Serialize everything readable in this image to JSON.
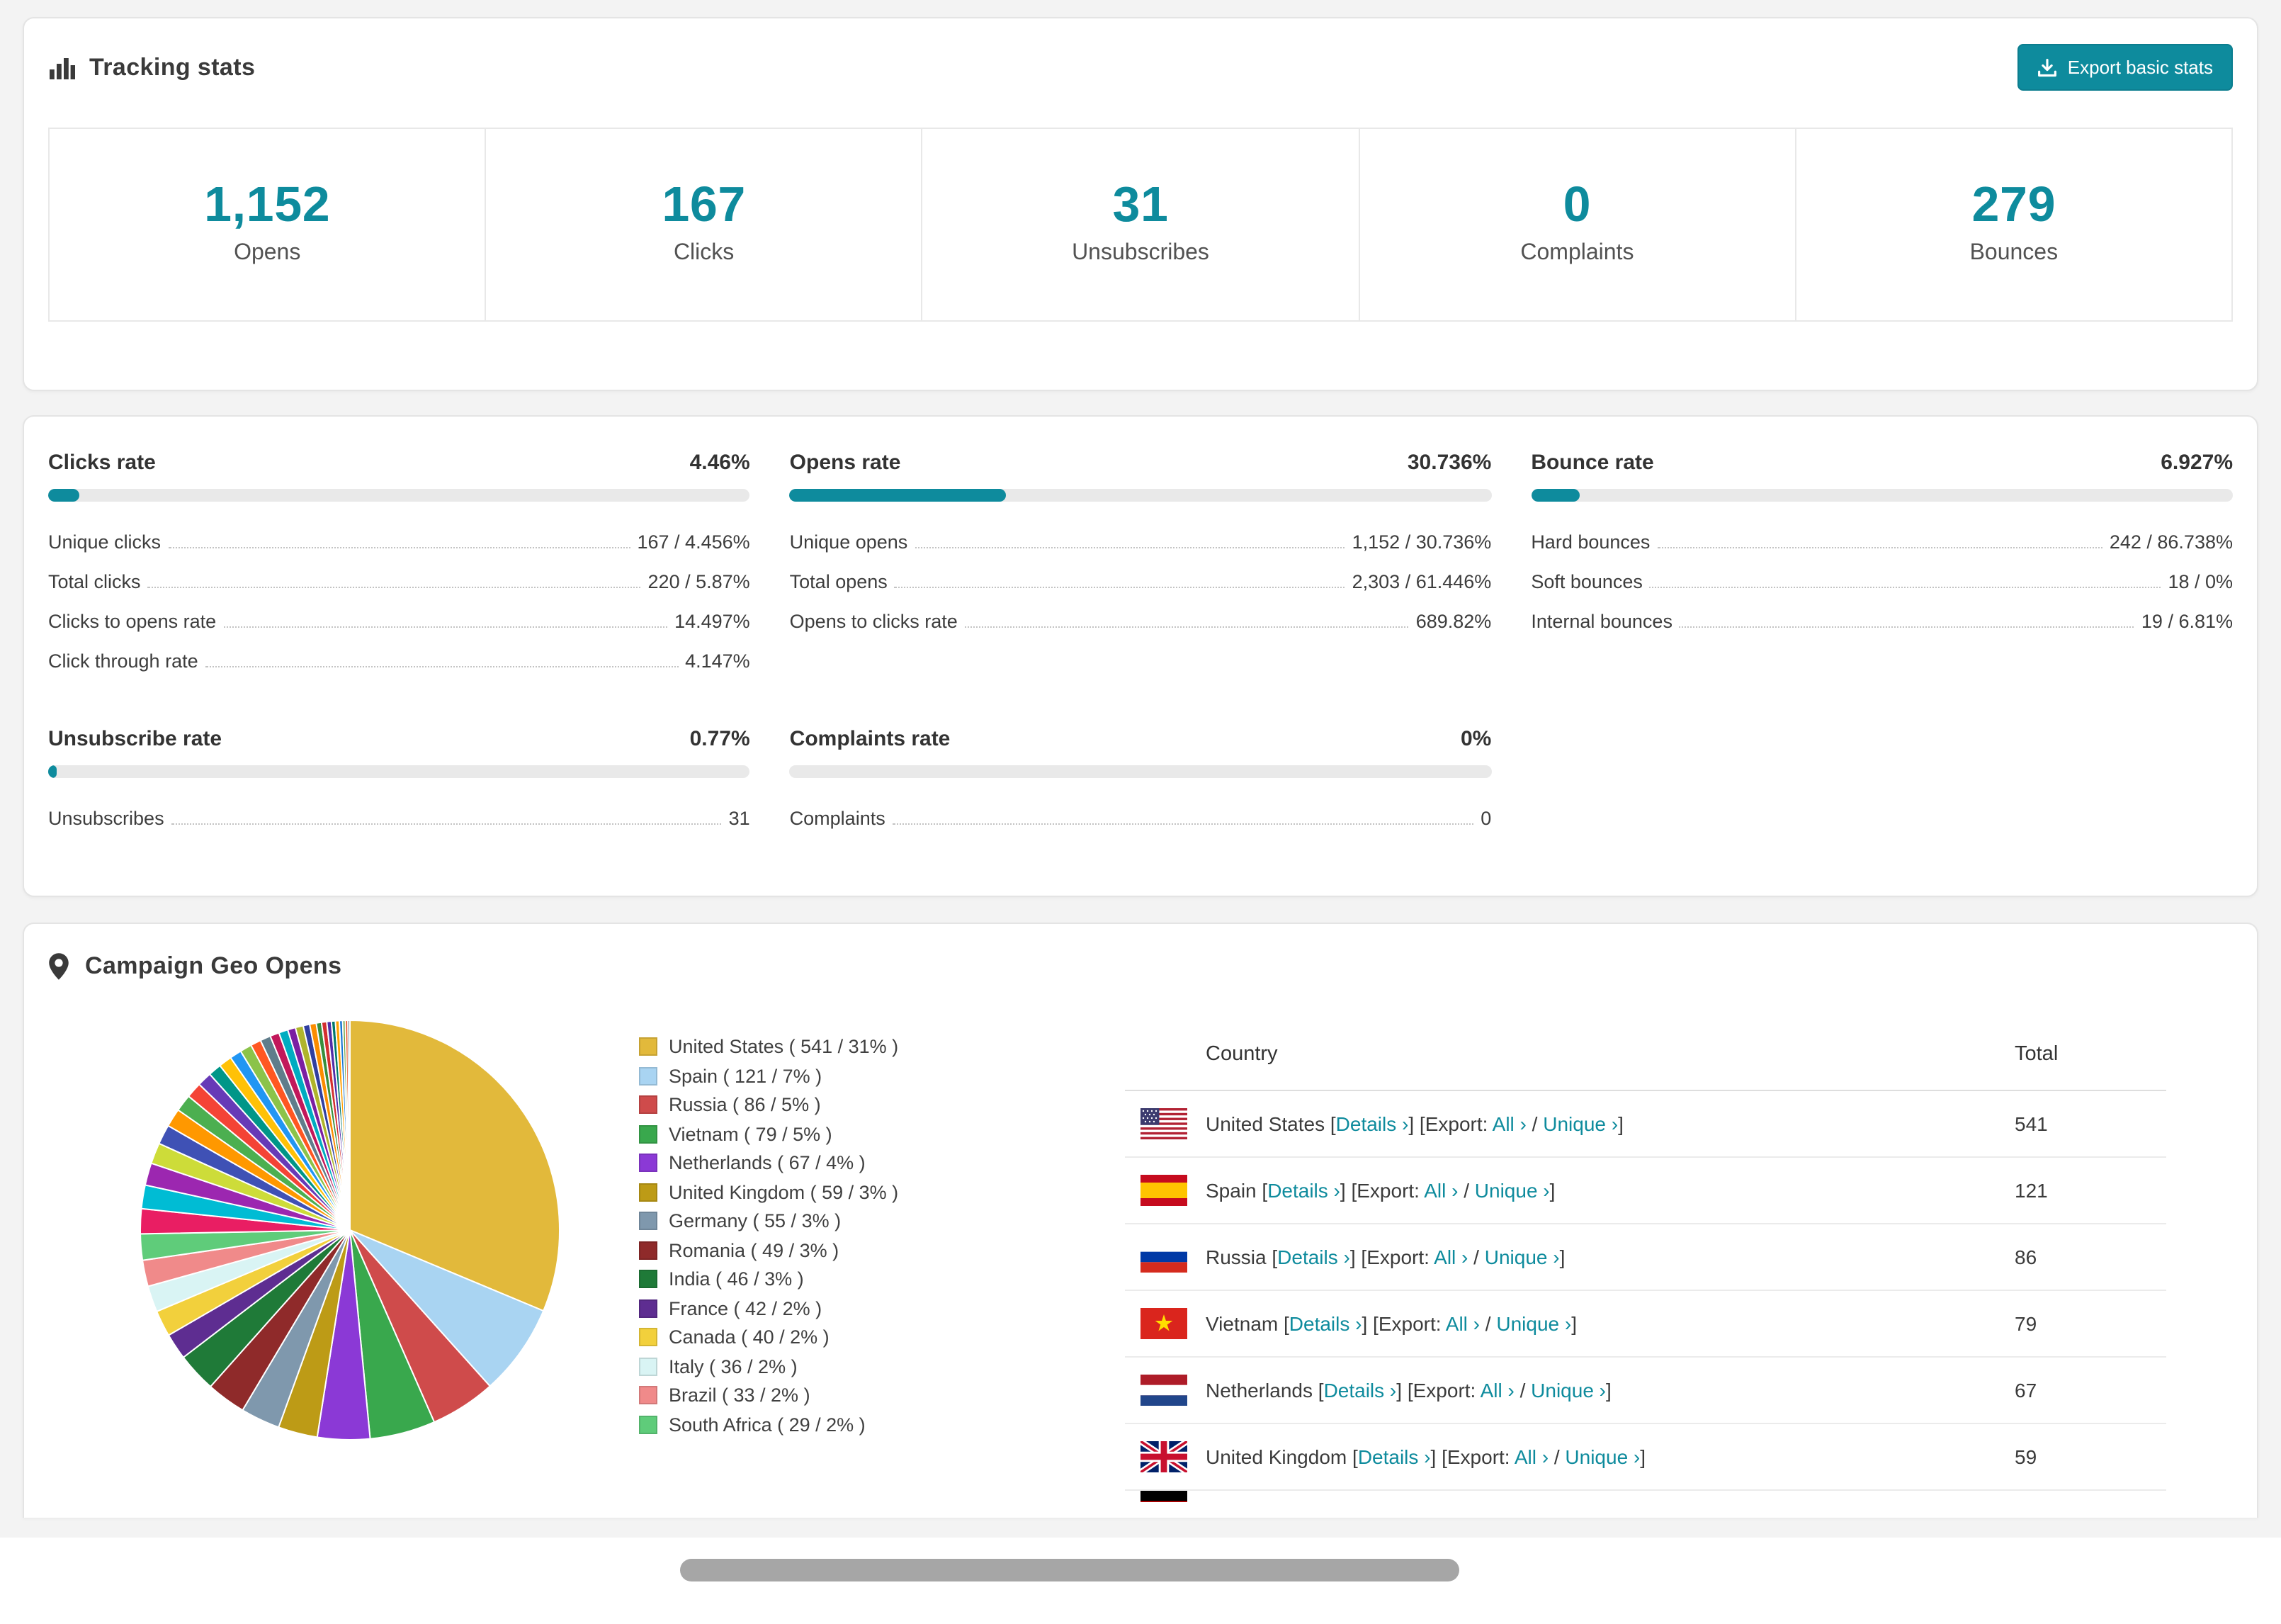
{
  "colors": {
    "accent": "#0e8b9d"
  },
  "tracking": {
    "title": "Tracking stats",
    "export_label": "Export basic stats",
    "stats": [
      {
        "value": "1,152",
        "label": "Opens"
      },
      {
        "value": "167",
        "label": "Clicks"
      },
      {
        "value": "31",
        "label": "Unsubscribes"
      },
      {
        "value": "0",
        "label": "Complaints"
      },
      {
        "value": "279",
        "label": "Bounces"
      }
    ]
  },
  "rates": [
    {
      "title": "Clicks rate",
      "value": "4.46%",
      "pct": 4.46,
      "rows": [
        {
          "label": "Unique clicks",
          "value": "167 / 4.456%"
        },
        {
          "label": "Total clicks",
          "value": "220 / 5.87%"
        },
        {
          "label": "Clicks to opens rate",
          "value": "14.497%"
        },
        {
          "label": "Click through rate",
          "value": "4.147%"
        }
      ]
    },
    {
      "title": "Opens rate",
      "value": "30.736%",
      "pct": 30.736,
      "rows": [
        {
          "label": "Unique opens",
          "value": "1,152 / 30.736%"
        },
        {
          "label": "Total opens",
          "value": "2,303 / 61.446%"
        },
        {
          "label": "Opens to clicks rate",
          "value": "689.82%"
        }
      ]
    },
    {
      "title": "Bounce rate",
      "value": "6.927%",
      "pct": 6.927,
      "rows": [
        {
          "label": "Hard bounces",
          "value": "242 / 86.738%"
        },
        {
          "label": "Soft bounces",
          "value": "18 / 0%"
        },
        {
          "label": "Internal bounces",
          "value": "19 / 6.81%"
        }
      ]
    },
    {
      "title": "Unsubscribe rate",
      "value": "0.77%",
      "pct": 0.77,
      "rows": [
        {
          "label": "Unsubscribes",
          "value": "31"
        }
      ]
    },
    {
      "title": "Complaints rate",
      "value": "0%",
      "pct": 0,
      "rows": [
        {
          "label": "Complaints",
          "value": "0"
        }
      ]
    }
  ],
  "geo": {
    "title": "Campaign Geo Opens",
    "table": {
      "headers": [
        "Country",
        "Total"
      ],
      "links": {
        "details": "Details ›",
        "export_prefix": "[Export:",
        "all": "All ›",
        "slash": "/",
        "unique": "Unique ›",
        "open": "[",
        "close": "]"
      },
      "rows": [
        {
          "country": "United States",
          "flag": "us",
          "total": "541"
        },
        {
          "country": "Spain",
          "flag": "es",
          "total": "121"
        },
        {
          "country": "Russia",
          "flag": "ru",
          "total": "86"
        },
        {
          "country": "Vietnam",
          "flag": "vn",
          "total": "79"
        },
        {
          "country": "Netherlands",
          "flag": "nl",
          "total": "67"
        },
        {
          "country": "United Kingdom",
          "flag": "gb",
          "total": "59"
        }
      ],
      "partial_row_flag": "de"
    }
  },
  "chart_data": {
    "type": "pie",
    "title": "Campaign Geo Opens",
    "legend_position": "right",
    "slices": [
      {
        "label": "United States",
        "count": 541,
        "pct": 31,
        "color": "#e2b93b"
      },
      {
        "label": "Spain",
        "count": 121,
        "pct": 7,
        "color": "#a9d4f2"
      },
      {
        "label": "Russia",
        "count": 86,
        "pct": 5,
        "color": "#cf4b4b"
      },
      {
        "label": "Vietnam",
        "count": 79,
        "pct": 5,
        "color": "#39a84d"
      },
      {
        "label": "Netherlands",
        "count": 67,
        "pct": 4,
        "color": "#8b39d6"
      },
      {
        "label": "United Kingdom",
        "count": 59,
        "pct": 3,
        "color": "#bd9b16"
      },
      {
        "label": "Germany",
        "count": 55,
        "pct": 3,
        "color": "#7f98ad"
      },
      {
        "label": "Romania",
        "count": 49,
        "pct": 3,
        "color": "#8f2a2a"
      },
      {
        "label": "India",
        "count": 46,
        "pct": 3,
        "color": "#1f7a38"
      },
      {
        "label": "France",
        "count": 42,
        "pct": 2,
        "color": "#5e2d91"
      },
      {
        "label": "Canada",
        "count": 40,
        "pct": 2,
        "color": "#f2d03c"
      },
      {
        "label": "Italy",
        "count": 36,
        "pct": 2,
        "color": "#d9f4f4"
      },
      {
        "label": "Brazil",
        "count": 33,
        "pct": 2,
        "color": "#f08a8a"
      },
      {
        "label": "South Africa",
        "count": 29,
        "pct": 2,
        "color": "#5fcc7a"
      }
    ],
    "other_slices": [
      {
        "pct": 1.9,
        "color": "#e91e63"
      },
      {
        "pct": 1.8,
        "color": "#00bcd4"
      },
      {
        "pct": 1.7,
        "color": "#9c27b0"
      },
      {
        "pct": 1.6,
        "color": "#cddc39"
      },
      {
        "pct": 1.5,
        "color": "#3f51b5"
      },
      {
        "pct": 1.4,
        "color": "#ff9800"
      },
      {
        "pct": 1.3,
        "color": "#4caf50"
      },
      {
        "pct": 1.2,
        "color": "#f44336"
      },
      {
        "pct": 1.1,
        "color": "#673ab7"
      },
      {
        "pct": 1.0,
        "color": "#009688"
      },
      {
        "pct": 1.0,
        "color": "#ffc107"
      },
      {
        "pct": 0.9,
        "color": "#2196f3"
      },
      {
        "pct": 0.9,
        "color": "#8bc34a"
      },
      {
        "pct": 0.8,
        "color": "#ff5722"
      },
      {
        "pct": 0.8,
        "color": "#607d8b"
      },
      {
        "pct": 0.7,
        "color": "#c2185b"
      },
      {
        "pct": 0.7,
        "color": "#00acc1"
      },
      {
        "pct": 0.6,
        "color": "#7b1fa2"
      },
      {
        "pct": 0.6,
        "color": "#afb42b"
      },
      {
        "pct": 0.5,
        "color": "#303f9f"
      },
      {
        "pct": 0.5,
        "color": "#fb8c00"
      },
      {
        "pct": 0.4,
        "color": "#388e3c"
      },
      {
        "pct": 0.4,
        "color": "#d32f2f"
      },
      {
        "pct": 0.35,
        "color": "#512da8"
      },
      {
        "pct": 0.3,
        "color": "#00796b"
      },
      {
        "pct": 0.3,
        "color": "#ffa000"
      },
      {
        "pct": 0.25,
        "color": "#1976d2"
      },
      {
        "pct": 0.2,
        "color": "#689f38"
      },
      {
        "pct": 0.2,
        "color": "#e64a19"
      },
      {
        "pct": 0.15,
        "color": "#455a64"
      }
    ]
  }
}
